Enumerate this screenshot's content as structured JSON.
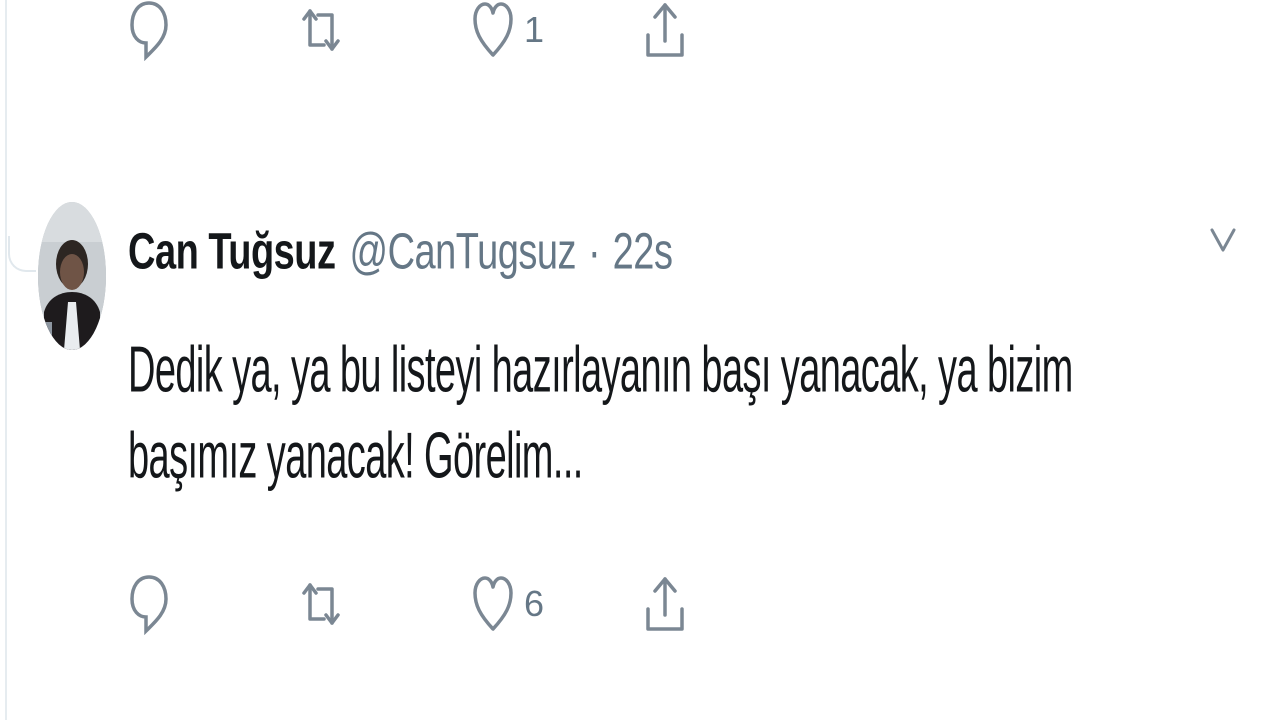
{
  "top_actions": {
    "reply_count": "",
    "retweet_count": "",
    "like_count": "1",
    "icons": [
      "reply-icon",
      "retweet-icon",
      "like-icon",
      "share-icon"
    ]
  },
  "tweet": {
    "display_name": "Can Tuğsuz",
    "handle": "@CanTugsuz",
    "separator": "·",
    "timestamp": "22s",
    "text": "Dedik ya, ya bu listeyi hazırlayanın başı yanacak, ya bizim başımız yanacak! Görelim...",
    "actions": {
      "reply_count": "",
      "retweet_count": "",
      "like_count": "6"
    }
  },
  "colors": {
    "text": "#14171a",
    "muted": "#657786",
    "border": "#e6ecf0"
  }
}
